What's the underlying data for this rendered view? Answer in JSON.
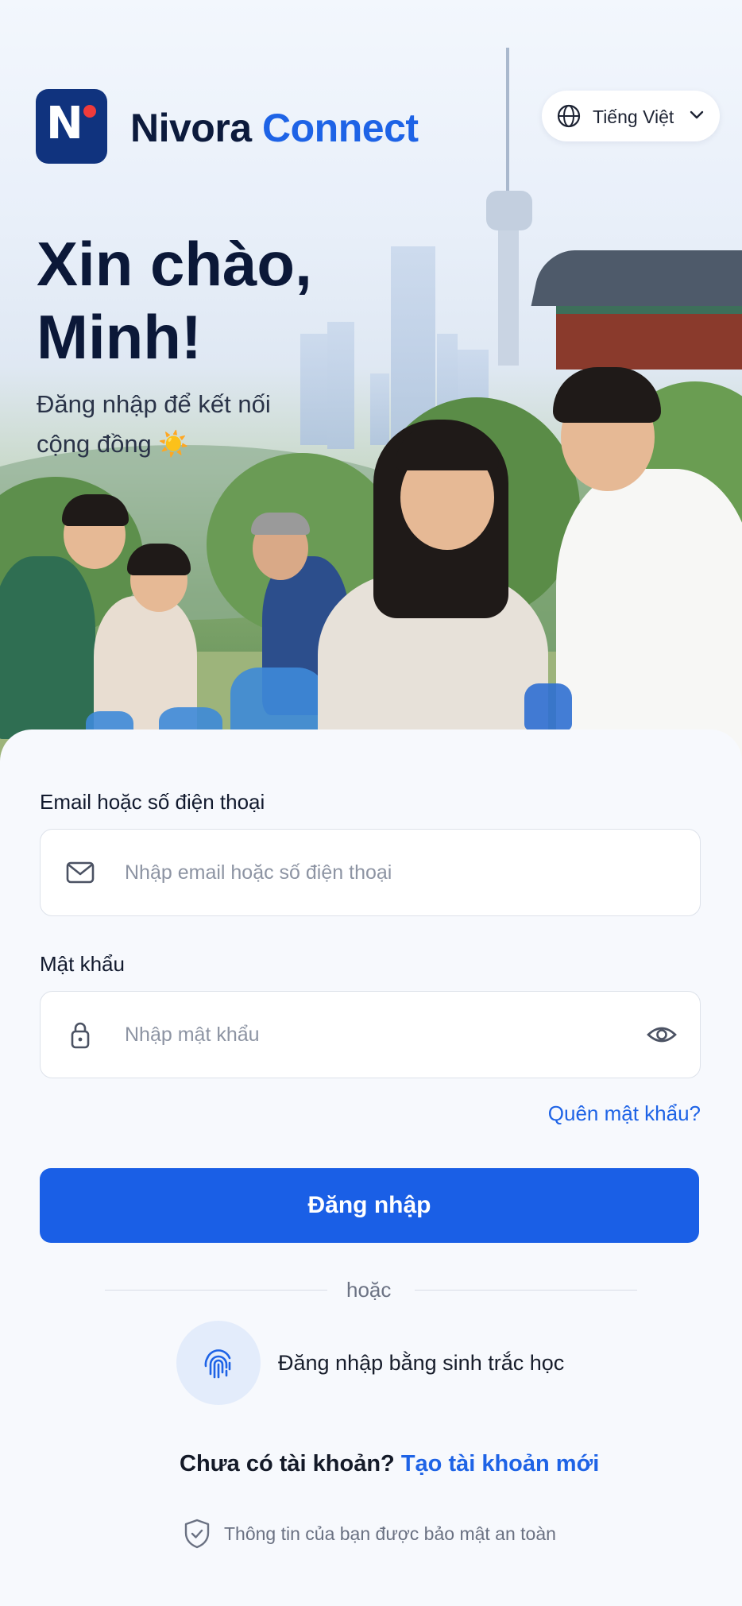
{
  "app": {
    "brand_primary": "Nivora",
    "brand_accent": "Connect",
    "accent_color": "#1e63e6"
  },
  "language": {
    "label": "Tiếng Việt",
    "icon": "globe-icon"
  },
  "hero": {
    "greeting_line1": "Xin chào,",
    "greeting_line2": "Minh!",
    "subtitle": "Đăng nhập để kết nối cộng đồng ☀️"
  },
  "form": {
    "email_label": "Email hoặc số điện thoại",
    "email_placeholder": "Nhập email hoặc số điện thoại",
    "password_label": "Mật khẩu",
    "password_placeholder": "Nhập mật khẩu",
    "forgot_label": "Quên mật khẩu?",
    "login_label": "Đăng nhập",
    "or_label": "hoặc",
    "biometric_label": "Đăng nhập bằng sinh trắc học"
  },
  "footer": {
    "no_account": "Chưa có tài khoản?",
    "create_account": "Tạo tài khoản mới",
    "security_note": "Thông tin của bạn được bảo mật an toàn"
  }
}
